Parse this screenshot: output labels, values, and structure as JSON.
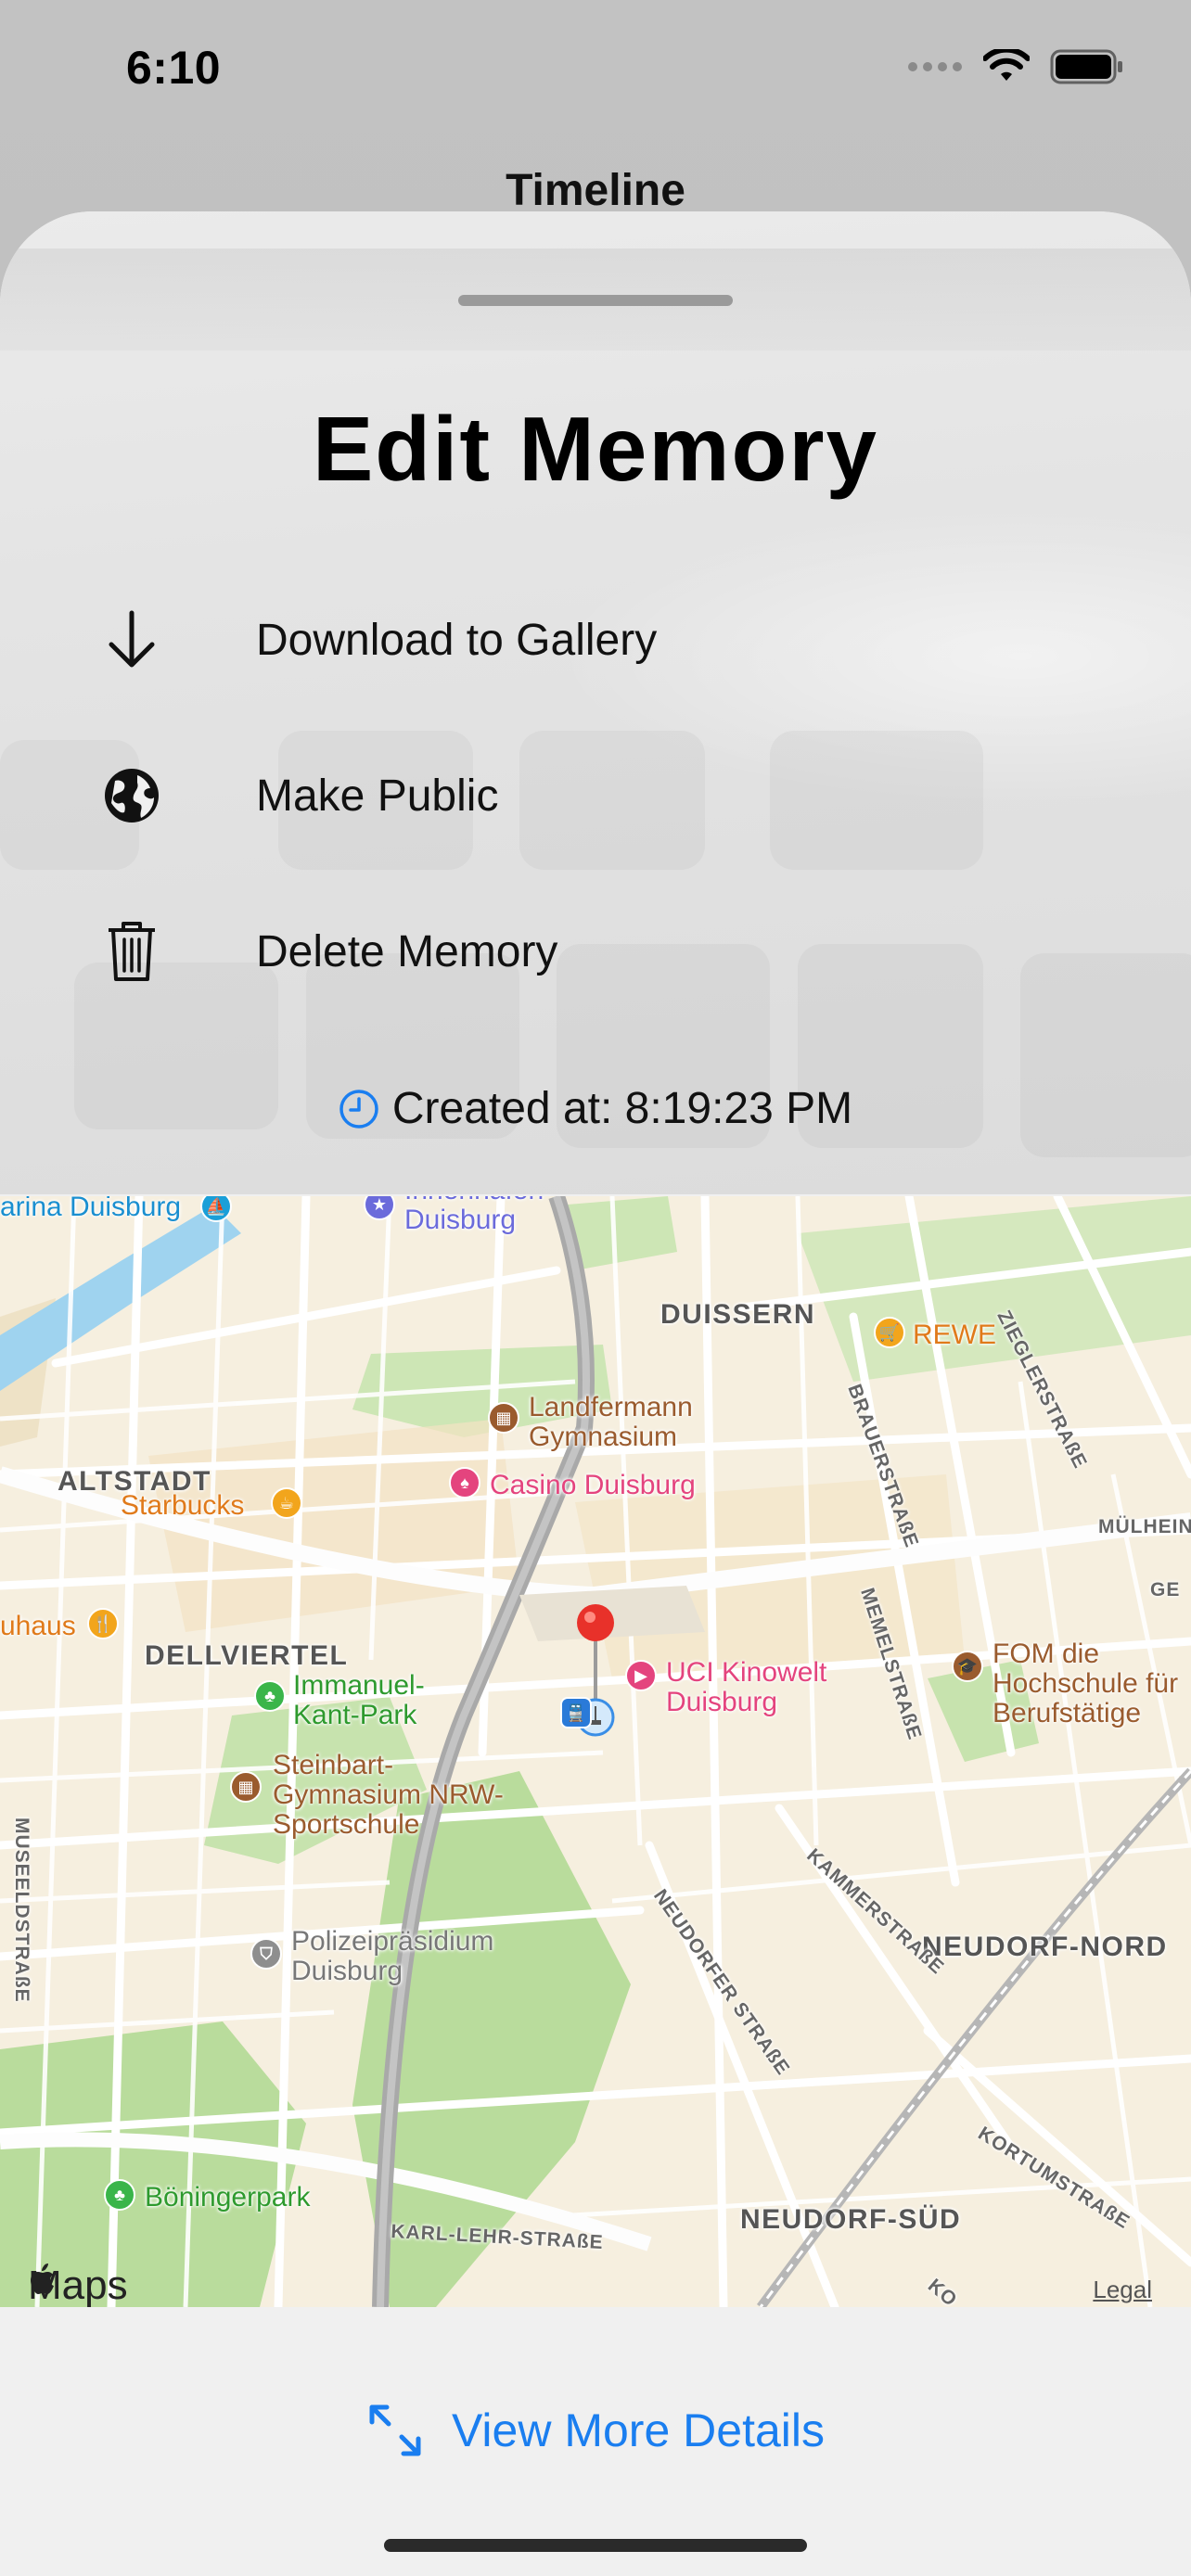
{
  "status_bar": {
    "time": "6:10"
  },
  "background": {
    "title": "Timeline"
  },
  "sheet": {
    "title": "Edit Memory",
    "menu": [
      {
        "label": "Download to Gallery",
        "icon": "arrow-down-icon"
      },
      {
        "label": "Make Public",
        "icon": "globe-icon"
      },
      {
        "label": "Delete Memory",
        "icon": "trash-icon"
      }
    ],
    "created_at": "Created at: 8:19:23 PM",
    "view_more_label": "View More Details"
  },
  "map": {
    "provider": "Maps",
    "legal": "Legal",
    "districts": {
      "duissern": "DUISSERN",
      "altstadt": "ALTSTADT",
      "dellviertel": "DELLVIERTEL",
      "neudorf_nord": "NEUDORF-NORD",
      "neudorf_sud": "NEUDORF-SÜD"
    },
    "streets": {
      "zieglerstrasse": "ZIEGLERSTRAßE",
      "brauerstrasse": "BRAUERSTRAßE",
      "muelheimer": "MÜLHEIN",
      "memelstrasse": "MEMELSTRAßE",
      "kammerstrasse": "KAMMERSTRAßE",
      "neudorfer_strasse": "NEUDORFER STRAßE",
      "museelstrasse": "MUSEELDSTRAßE",
      "karl_lehr": "KARL-LEHR-STRAßE",
      "kortumstrasse": "KORTUMSTRAßE",
      "ge": "GE",
      "ko": "KO"
    },
    "pois": {
      "marina": "arina Duisburg",
      "innenhafen_1": "Innenhafen",
      "innenhafen_2": "Duisburg",
      "rewe": "REWE",
      "landfermann_1": "Landfermann",
      "landfermann_2": "Gymnasium",
      "casino": "Casino Duisburg",
      "starbucks": "Starbucks",
      "brauhaus": "uhaus",
      "immanuel_1": "Immanuel-",
      "immanuel_2": "Kant-Park",
      "uci_1": "UCI Kinowelt",
      "uci_2": "Duisburg",
      "fom_1": "FOM die",
      "fom_2": "Hochschule für",
      "fom_3": "Berufstätige",
      "steinbart_1": "Steinbart-",
      "steinbart_2": "Gymnasium NRW-",
      "steinbart_3": "Sportschule",
      "polizei_1": "Polizeipräsidium",
      "polizei_2": "Duisburg",
      "boeninger": "Böningerpark"
    },
    "colors": {
      "land": "#f6efdf",
      "park": "#b9e0a0",
      "water": "#9fd3ef",
      "highway": "#a9a9a9",
      "pin": "#e8312a"
    }
  }
}
